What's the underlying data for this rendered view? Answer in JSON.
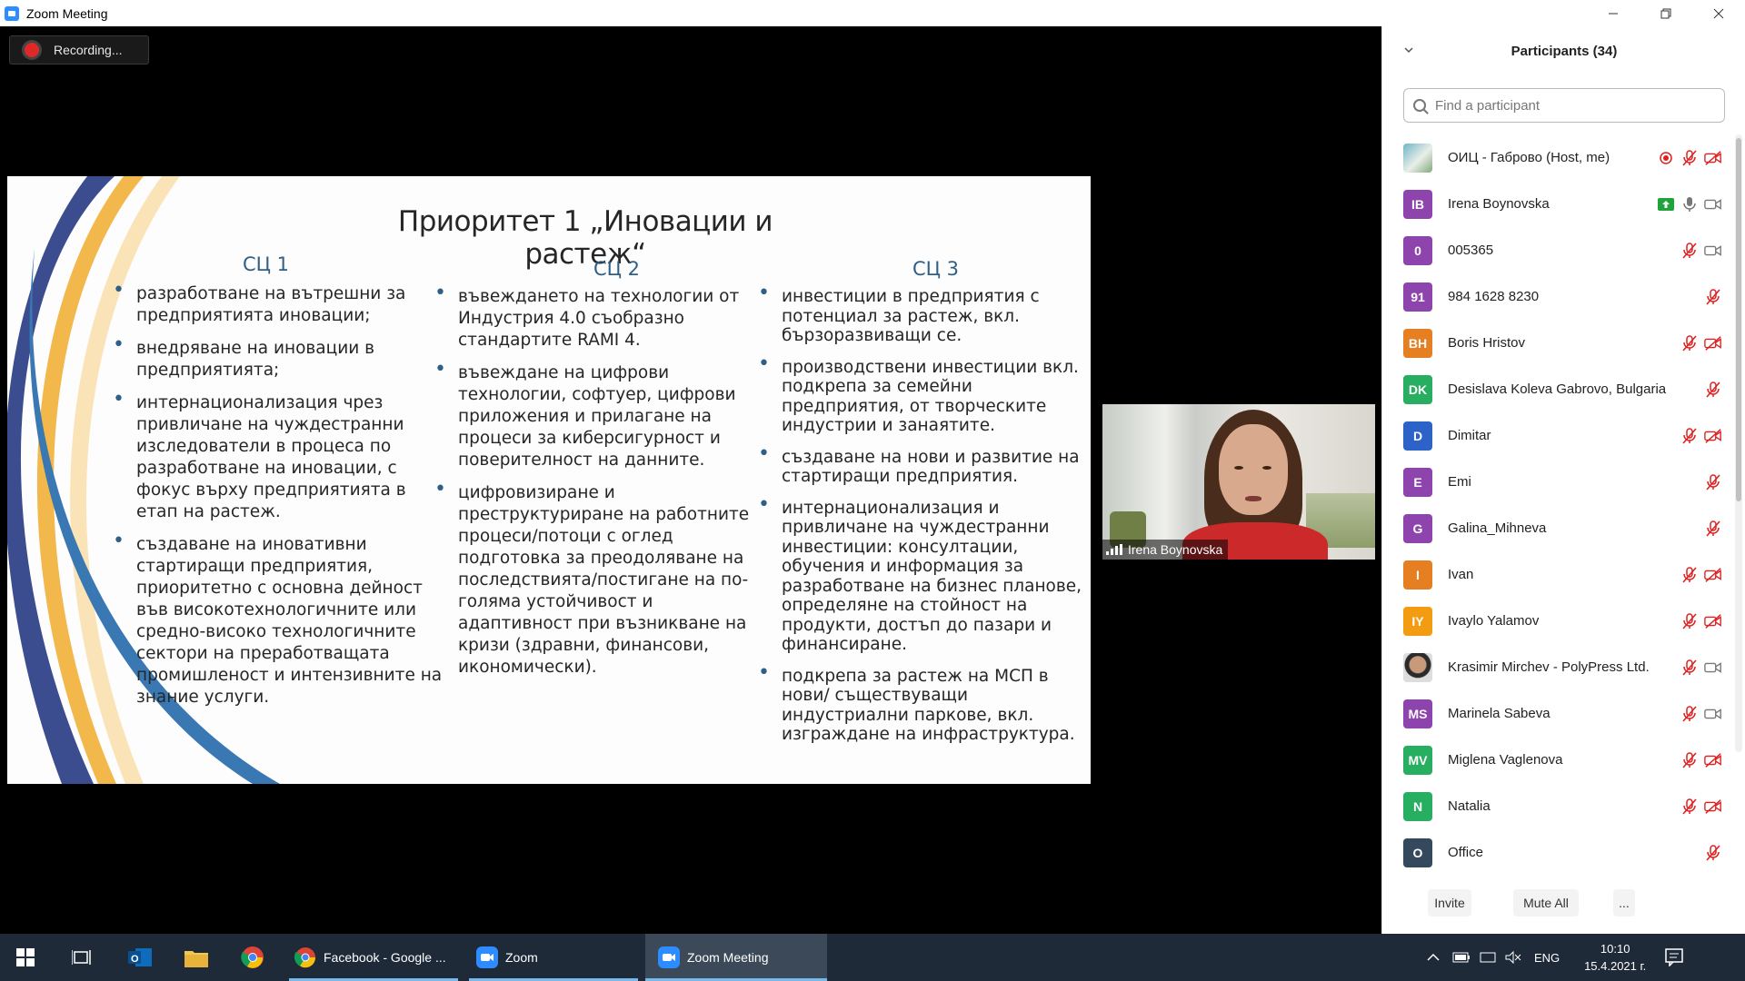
{
  "window": {
    "title": "Zoom Meeting",
    "controls": [
      "minimize-icon",
      "restore-icon",
      "close-icon"
    ]
  },
  "recording": {
    "label": "Recording..."
  },
  "slide": {
    "title": "Приоритет 1 „Иновации и растеж“",
    "columns": [
      {
        "heading": "СЦ 1",
        "items": [
          "разработване на вътрешни за предприятията иновации;",
          "внедряване на иновации в предприятията;",
          "интернационализация чрез привличане на чуждестранни изследователи в процеса по разработване на иновации, с фокус върху предприятията в етап на растеж.",
          "създаване на иновативни стартиращи предприятия, приоритетно с основна дейност във високотехнологичните или средно-високо технологичните сектори на преработващата промишленост и интензивните на знание услуги."
        ]
      },
      {
        "heading": "СЦ 2",
        "items": [
          "въвеждането на технологии от Индустрия 4.0 съобразно стандартите RAMI 4.",
          "въвеждане на цифрови технологии, софтуер, цифрови приложения и прилагане на процеси за киберсигурност и поверителност на данните.",
          "цифровизиране и преструктуриране на работните процеси/потоци с оглед подготовка за преодоляване на последствията/постигане на по-голяма устойчивост и адаптивност при възникване на кризи (здравни, финансови, икономически)."
        ]
      },
      {
        "heading": "СЦ 3",
        "items": [
          "инвестиции в предприятия с потенциал за растеж, вкл. бързоразвиващи се.",
          "производствени инвестиции вкл. подкрепа за семейни предприятия, от творческите индустрии и занаятите.",
          "създаване на нови и развитие на стартиращи предприятия.",
          "интернационализация и привличане на чуждестранни инвестиции: консултации, обучения и информация за разработване на бизнес планове, определяне на стойност на продукти, достъп до пазари и финансиране.",
          "подкрепа за растеж на МСП в нови/ съществуващи индустриални паркове, вкл. изграждане на инфраструктура."
        ]
      }
    ]
  },
  "video": {
    "name": "Irena Boynovska"
  },
  "participants": {
    "header": "Participants (34)",
    "search_placeholder": "Find a participant",
    "list": [
      {
        "name": "ОИЦ - Габрово (Host, me)",
        "avatar": "photo",
        "color": "#5aa6b8",
        "icons": [
          "record-icon",
          "mic-muted-icon",
          "video-off-icon"
        ]
      },
      {
        "name": "Irena Boynovska",
        "avatar": "IB",
        "color": "#8e44ad",
        "icons": [
          "share-screen-icon",
          "mic-icon",
          "video-icon"
        ]
      },
      {
        "name": "005365",
        "avatar": "0",
        "color": "#8e44ad",
        "icons": [
          "mic-muted-icon",
          "video-icon"
        ]
      },
      {
        "name": "984 1628 8230",
        "avatar": "91",
        "color": "#8e44ad",
        "icons": [
          "mic-muted-icon"
        ]
      },
      {
        "name": "Boris Hristov",
        "avatar": "BH",
        "color": "#e67e22",
        "icons": [
          "mic-muted-icon",
          "video-off-icon"
        ]
      },
      {
        "name": "Desislava Koleva Gabrovo, Bulgaria",
        "avatar": "DK",
        "color": "#27ae60",
        "icons": [
          "mic-muted-icon"
        ]
      },
      {
        "name": "Dimitar",
        "avatar": "D",
        "color": "#2d63c8",
        "icons": [
          "mic-muted-icon",
          "video-off-icon"
        ]
      },
      {
        "name": "Emi",
        "avatar": "E",
        "color": "#8e44ad",
        "icons": [
          "mic-muted-icon"
        ]
      },
      {
        "name": "Galina_Mihneva",
        "avatar": "G",
        "color": "#8e44ad",
        "icons": [
          "mic-muted-icon"
        ]
      },
      {
        "name": "Ivan",
        "avatar": "I",
        "color": "#e67e22",
        "icons": [
          "mic-muted-icon",
          "video-off-icon"
        ]
      },
      {
        "name": "Ivaylo Yalamov",
        "avatar": "IY",
        "color": "#f39c12",
        "icons": [
          "mic-muted-icon",
          "video-off-icon"
        ]
      },
      {
        "name": "Krasimir Mirchev - PolyPress Ltd.",
        "avatar": "photo2",
        "color": "#555555",
        "icons": [
          "mic-muted-icon",
          "video-icon"
        ]
      },
      {
        "name": "Marinela Sabeva",
        "avatar": "MS",
        "color": "#8e44ad",
        "icons": [
          "mic-muted-icon",
          "video-icon"
        ]
      },
      {
        "name": "Miglena Vaglenova",
        "avatar": "MV",
        "color": "#27ae60",
        "icons": [
          "mic-muted-icon",
          "video-off-icon"
        ]
      },
      {
        "name": "Natalia",
        "avatar": "N",
        "color": "#27ae60",
        "icons": [
          "mic-muted-icon",
          "video-off-icon"
        ]
      },
      {
        "name": "Office",
        "avatar": "O",
        "color": "#34495e",
        "icons": [
          "mic-muted-icon"
        ]
      }
    ],
    "footer": {
      "invite": "Invite",
      "mute_all": "Mute All",
      "more": "..."
    }
  },
  "taskbar": {
    "apps": [
      {
        "label": "Facebook - Google ...",
        "icon": "chrome-icon"
      },
      {
        "label": "Zoom",
        "icon": "zoom-icon"
      },
      {
        "label": "Zoom Meeting",
        "icon": "zoom-icon",
        "active": true
      }
    ],
    "language": "ENG",
    "time": "10:10",
    "date": "15.4.2021 г."
  }
}
